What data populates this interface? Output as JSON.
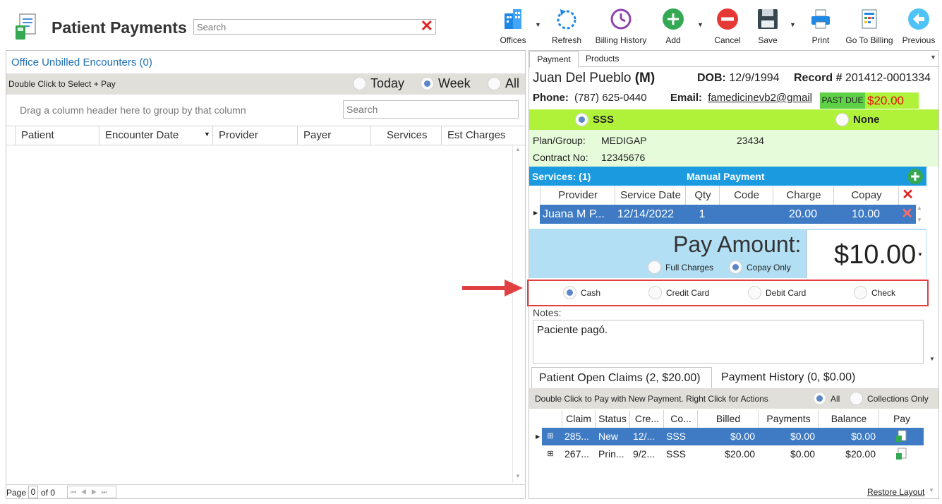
{
  "header": {
    "title": "Patient Payments",
    "search_placeholder": "Search"
  },
  "toolbar": {
    "offices": "Offices",
    "refresh": "Refresh",
    "billing_history": "Billing History",
    "add": "Add",
    "cancel": "Cancel",
    "save": "Save",
    "print": "Print",
    "go_to_billing": "Go To Billing",
    "previous": "Previous"
  },
  "left": {
    "heading": "Office Unbilled Encounters (0)",
    "hint": "Double Click to Select + Pay",
    "filters": {
      "today": "Today",
      "week": "Week",
      "all": "All",
      "selected": "Week"
    },
    "group_hint": "Drag a column header here to group by that column",
    "search_placeholder": "Search",
    "columns": [
      "Patient",
      "Encounter Date",
      "Provider",
      "Payer",
      "Services",
      "Est Charges"
    ],
    "pager": {
      "page_label": "Page",
      "page": "0",
      "of": "of 0"
    }
  },
  "right": {
    "tabs": {
      "payment": "Payment",
      "products": "Products"
    },
    "patient": {
      "name": "Juan Del Pueblo",
      "gender": "(M)",
      "dob_label": "DOB:",
      "dob": "12/9/1994",
      "record_label": "Record #",
      "record": "201412-0001334",
      "phone_label": "Phone:",
      "phone": "(787) 625-0440",
      "email_label": "Email:",
      "email": "famedicinevb2@gmail",
      "past_due_label": "PAST DUE",
      "past_due": "$20.00"
    },
    "insurance": {
      "primary": "SSS",
      "secondary": "None",
      "plan_label": "Plan/Group:",
      "plan": "MEDIGAP",
      "group": "23434",
      "contract_label": "Contract No:",
      "contract": "12345676"
    },
    "services": {
      "title": "Services: (1)",
      "manual": "Manual Payment",
      "columns": {
        "provider": "Provider",
        "date": "Service Date",
        "qty": "Qty",
        "code": "Code",
        "charge": "Charge",
        "copay": "Copay"
      },
      "row": {
        "provider": "Juana M P...",
        "date": "12/14/2022",
        "qty": "1",
        "code": "",
        "charge": "20.00",
        "copay": "10.00"
      }
    },
    "pay": {
      "label": "Pay Amount:",
      "amount": "$10.00",
      "full": "Full Charges",
      "copay_only": "Copay Only"
    },
    "methods": {
      "cash": "Cash",
      "credit": "Credit Card",
      "debit": "Debit Card",
      "check": "Check"
    },
    "notes": {
      "label": "Notes:",
      "text": "Paciente pagó."
    },
    "claims": {
      "tab_open": "Patient Open Claims (2, $20.00)",
      "tab_history": "Payment History (0, $0.00)",
      "hint": "Double Click to Pay with New Payment. Right Click for Actions",
      "all": "All",
      "collections": "Collections Only",
      "columns": {
        "claim": "Claim",
        "status": "Status",
        "created": "Cre...",
        "company": "Co...",
        "billed": "Billed",
        "payments": "Payments",
        "balance": "Balance",
        "pay": "Pay"
      },
      "rows": [
        {
          "claim": "285...",
          "status": "New",
          "created": "12/...",
          "company": "SSS",
          "billed": "$0.00",
          "payments": "$0.00",
          "balance": "$0.00"
        },
        {
          "claim": "267...",
          "status": "Prin...",
          "created": "9/2...",
          "company": "SSS",
          "billed": "$20.00",
          "payments": "$0.00",
          "balance": "$20.00"
        }
      ],
      "restore": "Restore Layout"
    }
  },
  "colors": {
    "accent_blue": "#1c9ae0",
    "row_selected": "#3e7bc4",
    "green": "#b0f23a",
    "pay_bg": "#b2dff4",
    "highlight_red": "#e04040"
  }
}
